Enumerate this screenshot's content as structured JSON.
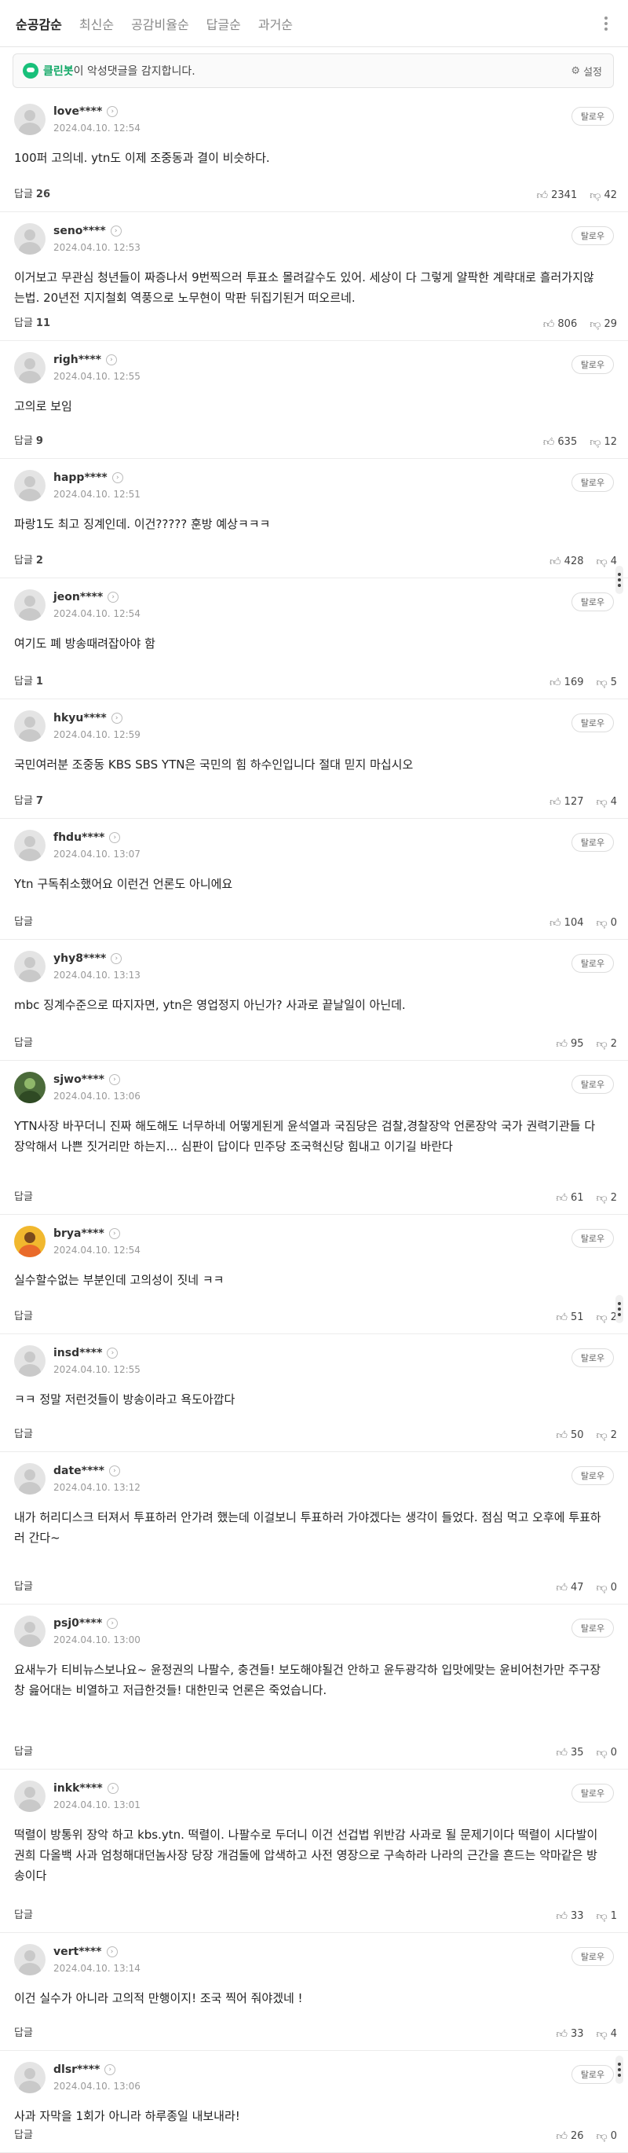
{
  "sort_tabs": [
    "순공감순",
    "최신순",
    "공감비율순",
    "답글순",
    "과거순"
  ],
  "cleanbot": {
    "name": "클린봇",
    "text": "이 악성댓글을 감지합니다.",
    "setting": "설정"
  },
  "report_label": "탈로우",
  "reply_label": "답글",
  "comments": [
    {
      "user": "love****",
      "date": "2024.04.10. 12:54",
      "text": "100퍼 고의네. ytn도 이제 조중동과 결이 비슷하다.",
      "replies": "26",
      "likes": "2341",
      "dislikes": "42"
    },
    {
      "user": "seno****",
      "date": "2024.04.10. 12:53",
      "text": "이거보고 무관심 청년들이 짜증나서 9번찍으러 투표소 몰려갈수도 있어. 세상이 다 그렇게 얄팍한 계략대로 흘러가지않는법. 20년전 지지철회 역풍으로 노무현이 막판 뒤집기된거 떠오르네.",
      "replies": "11",
      "likes": "806",
      "dislikes": "29"
    },
    {
      "user": "righ****",
      "date": "2024.04.10. 12:55",
      "text": "고의로 보임",
      "replies": "9",
      "likes": "635",
      "dislikes": "12"
    },
    {
      "user": "happ****",
      "date": "2024.04.10. 12:51",
      "text": "파랑1도 최고 징계인데. 이건????? 훈방 예상ㅋㅋㅋ",
      "replies": "2",
      "likes": "428",
      "dislikes": "4"
    },
    {
      "user": "jeon****",
      "date": "2024.04.10. 12:54",
      "text": "여기도 폐 방송때려잡아야 함",
      "replies": "1",
      "likes": "169",
      "dislikes": "5"
    },
    {
      "user": "hkyu****",
      "date": "2024.04.10. 12:59",
      "text": "국민여러분 조중동 KBS SBS YTN은 국민의 힘 하수인입니다 절대 믿지 마십시오",
      "replies": "7",
      "likes": "127",
      "dislikes": "4"
    },
    {
      "user": "fhdu****",
      "date": "2024.04.10. 13:07",
      "text": "Ytn 구독취소했어요 이런건 언론도 아니에요",
      "replies": "",
      "likes": "104",
      "dislikes": "0"
    },
    {
      "user": "yhy8****",
      "date": "2024.04.10. 13:13",
      "text": "mbc 징계수준으로 따지자면, ytn은 영업정지 아닌가? 사과로 끝날일이 아닌데.",
      "replies": "",
      "likes": "95",
      "dislikes": "2"
    },
    {
      "user": "sjwo****",
      "date": "2024.04.10. 13:06",
      "text": "YTN사장 바꾸더니 진짜 해도해도 너무하네 어떻게된게 윤석열과 국짐당은 검찰,경찰장악 언론장악 국가 권력기관들 다 장악해서 나쁜 짓거리만 하는지... 심판이 답이다 민주당 조국혁신당 힘내고 이기길 바란다",
      "replies": "",
      "likes": "61",
      "dislikes": "2"
    },
    {
      "user": "brya****",
      "date": "2024.04.10. 12:54",
      "text": "실수할수없는 부분인데 고의성이 짓네 ㅋㅋ",
      "replies": "",
      "likes": "51",
      "dislikes": "2"
    },
    {
      "user": "insd****",
      "date": "2024.04.10. 12:55",
      "text": "ㅋㅋ 정말 저런것들이 방송이라고 욕도아깝다",
      "replies": "",
      "likes": "50",
      "dislikes": "2"
    },
    {
      "user": "date****",
      "date": "2024.04.10. 13:12",
      "text": "내가 허리디스크 터져서 투표하러 안가려 했는데 이걸보니 투표하러 가야겠다는 생각이 들었다. 점심 먹고 오후에 투표하러 간다~",
      "replies": "",
      "likes": "47",
      "dislikes": "0"
    },
    {
      "user": "psj0****",
      "date": "2024.04.10. 13:00",
      "text": "요새누가 티비뉴스보나요~ 윤정권의 나팔수, 충견들! 보도해야될건 안하고 윤두광각하 입맛에맞는 윤비어천가만 주구장창 읊어대는 비열하고 저급한것들! 대한민국 언론은 죽었습니다.",
      "replies": "",
      "likes": "35",
      "dislikes": "0"
    },
    {
      "user": "inkk****",
      "date": "2024.04.10. 13:01",
      "text": "떡렬이 방통위 장악 하고 kbs.ytn. 떡렬이. 나팔수로 두더니 이건 선겁법 위반감 사과로 될 문제기이다 떡렬이 시다발이 권희 다올백 사과 엄청해대던놈사장 당장 개검돌에 압색하고 사전 영장으로 구속하라 나라의 근간을 흔드는 악마같은 방송이다",
      "replies": "",
      "likes": "33",
      "dislikes": "1"
    },
    {
      "user": "vert****",
      "date": "2024.04.10. 13:14",
      "text": "이건 실수가 아니라 고의적 만행이지! 조국 찍어 줘야겠네 !",
      "replies": "",
      "likes": "33",
      "dislikes": "4"
    },
    {
      "user": "dlsr****",
      "date": "2024.04.10. 13:06",
      "text": "사과 자막을 1회가 아니라 하루종일 내보내라!",
      "replies": "",
      "likes": "26",
      "dislikes": "0"
    }
  ]
}
